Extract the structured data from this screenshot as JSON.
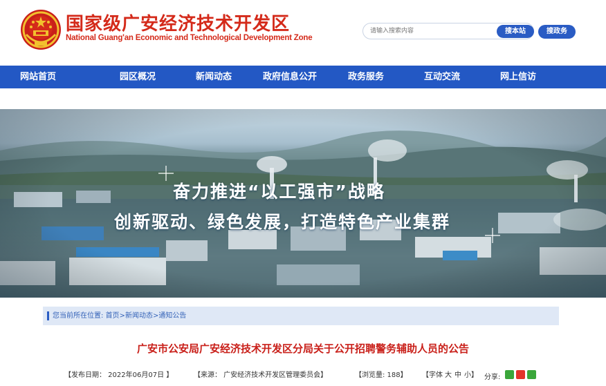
{
  "header": {
    "logo_cn": "国家级广安经济技术开发区",
    "logo_en": "National Guang'an Economic and Technological Development Zone",
    "search_placeholder": "请输入搜索内容",
    "search_button": "搜本站",
    "service_button": "搜政务"
  },
  "nav": {
    "items": [
      "网站首页",
      "园区概况",
      "新闻动态",
      "政府信息公开",
      "政务服务",
      "互动交流",
      "网上信访"
    ]
  },
  "banner": {
    "line1": "奋力推进“以工强市”战略",
    "line2": "创新驱动、绿色发展，打造特色产业集群"
  },
  "breadcrumb": {
    "prefix": "您当前所在位置:",
    "path": "首页>新闻动态>通知公告"
  },
  "article": {
    "title": "广安市公安局广安经济技术开发区分局关于公开招聘警务辅助人员的公告",
    "date": "【发布日期： 2022年06月07日 】",
    "source": "【来源：  广安经济技术开发区管理委员会】",
    "views": "【浏览量: 188】",
    "font_label": "【字体",
    "font_large": "大",
    "font_medium": "中",
    "font_small": "小】",
    "share_label": "分享:"
  },
  "colors": {
    "brand_red": "#d42a1a",
    "nav_blue": "#2358c4",
    "title_red": "#c9201a"
  }
}
